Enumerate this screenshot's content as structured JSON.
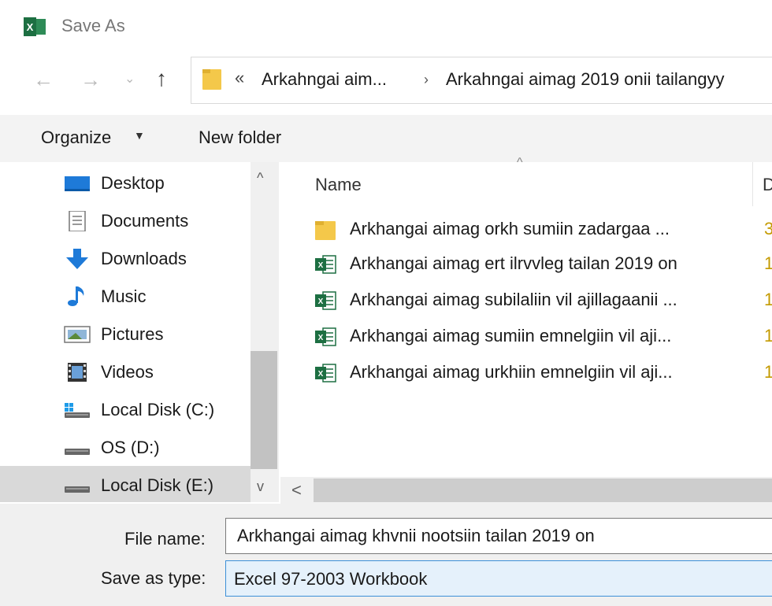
{
  "window": {
    "title": "Save As",
    "app_icon_label": "X"
  },
  "navigation": {
    "back_glyph": "←",
    "forward_glyph": "→",
    "recent_glyph": "⌄",
    "up_glyph": "↑"
  },
  "address_bar": {
    "overflow_chevron": "«",
    "segments": [
      "Arkahngai aim...",
      "Arkahngai aimag 2019 onii tailangyy"
    ],
    "separator": "›"
  },
  "toolbar": {
    "organize_label": "Organize",
    "organize_caret": "▼",
    "new_folder_label": "New folder"
  },
  "sidebar": {
    "items": [
      {
        "label": "Desktop",
        "icon": "desktop-icon"
      },
      {
        "label": "Documents",
        "icon": "documents-icon"
      },
      {
        "label": "Downloads",
        "icon": "downloads-icon"
      },
      {
        "label": "Music",
        "icon": "music-icon"
      },
      {
        "label": "Pictures",
        "icon": "pictures-icon"
      },
      {
        "label": "Videos",
        "icon": "videos-icon"
      },
      {
        "label": "Local Disk (C:)",
        "icon": "drive-icon"
      },
      {
        "label": "OS (D:)",
        "icon": "drive-icon"
      },
      {
        "label": "Local Disk (E:)",
        "icon": "drive-icon",
        "selected": true
      }
    ]
  },
  "scrollbar": {
    "up_glyph": "^",
    "down_glyph": "v",
    "left_glyph": "<"
  },
  "file_list": {
    "sort_glyph": "^",
    "columns": {
      "name": "Name",
      "date_partial": "D"
    },
    "rows": [
      {
        "name": "Arkhangai aimag orkh sumiin  zadargaa ...",
        "type": "folder",
        "tail": "3"
      },
      {
        "name": "Arkhangai aimag ert ilrvvleg tailan 2019 on",
        "type": "excel",
        "tail": "1"
      },
      {
        "name": "Arkhangai aimag subilaliin vil ajillagaanii ...",
        "type": "excel",
        "tail": "1"
      },
      {
        "name": "Arkhangai aimag sumiin emnelgiin vil aji...",
        "type": "excel",
        "tail": "1"
      },
      {
        "name": "Arkhangai aimag urkhiin emnelgiin vil aji...",
        "type": "excel",
        "tail": "1"
      }
    ]
  },
  "form": {
    "file_name_label": "File name:",
    "file_name_value": "Arkhangai aimag khvnii nootsiin tailan 2019 on",
    "save_as_type_label": "Save as type:",
    "save_as_type_value": "Excel 97-2003 Workbook"
  },
  "colors": {
    "excel_green": "#1d6f42",
    "folder_yellow": "#f4c84a",
    "selection_gray": "#d9d9d9",
    "focus_blue": "#3c8fd8"
  }
}
